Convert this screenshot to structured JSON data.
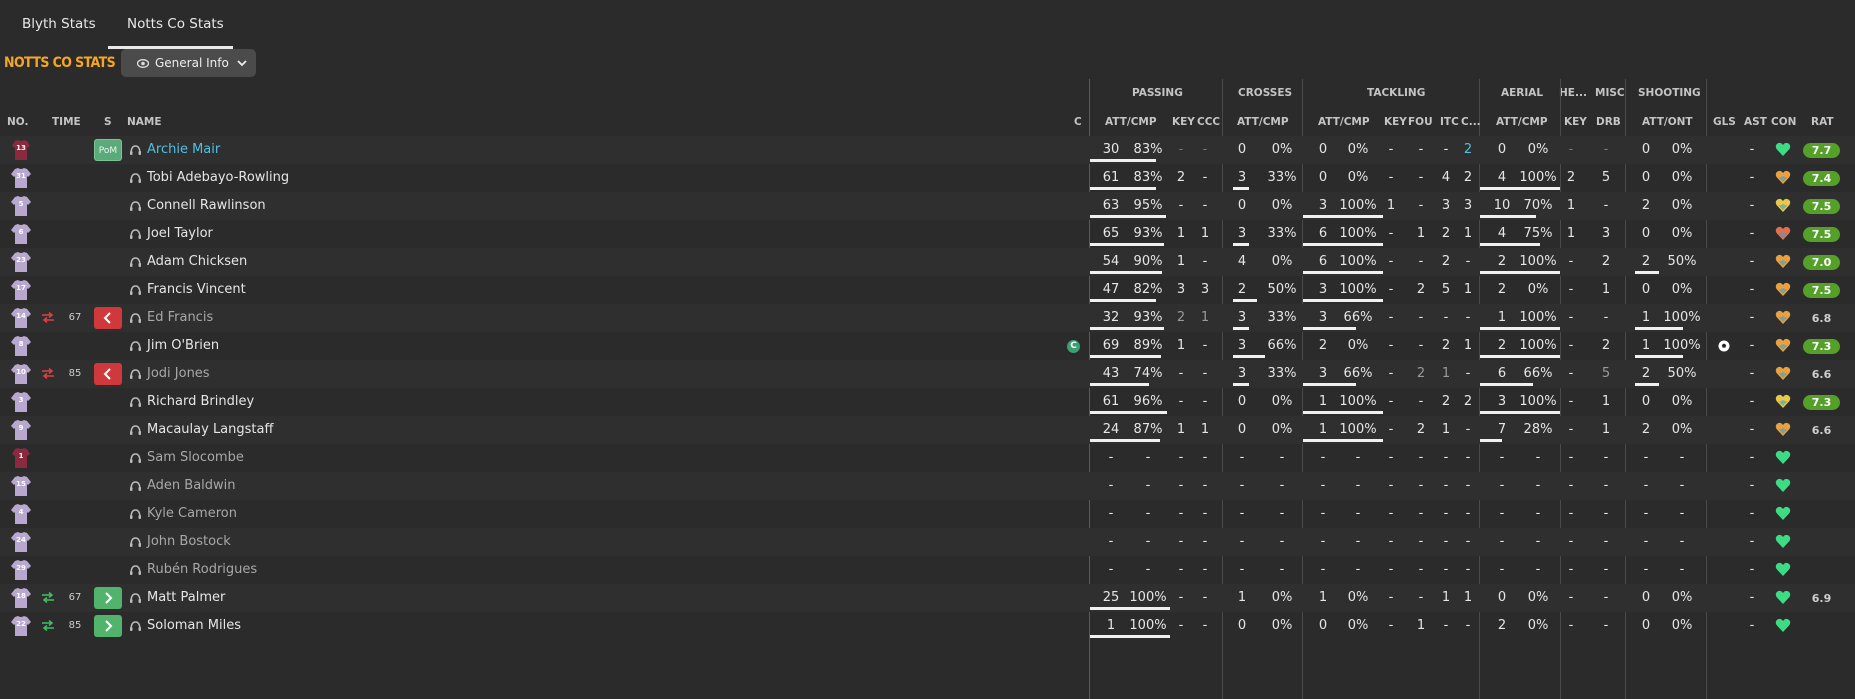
{
  "tabs": [
    {
      "label": "Blyth Stats"
    },
    {
      "label": "Notts Co Stats"
    }
  ],
  "title": "NOTTS CO STATS",
  "view_selector": {
    "label": "General Info"
  },
  "groups": {
    "passing": "PASSING",
    "crosses": "CROSSES",
    "tackling": "TACKLING",
    "aerial": "AERIAL",
    "headers": "HE...",
    "misc": "MISC",
    "shooting": "SHOOTING"
  },
  "columns": {
    "no": "NO.",
    "time": "TIME",
    "s": "S",
    "name": "NAME",
    "c": "C",
    "pass_att_cmp": "ATT/CMP",
    "pass_key": "KEY",
    "pass_ccc": "CCC",
    "cross_att_cmp": "ATT/CMP",
    "tack_att_cmp": "ATT/CMP",
    "tack_key": "KEY",
    "tack_fou": "FOU",
    "tack_itc": "ITC",
    "tack_c": "C...",
    "aer_att_cmp": "ATT/CMP",
    "he_key": "KEY",
    "misc_drb": "DRB",
    "shot_att_ont": "ATT/ONT",
    "gls": "GLS",
    "ast": "AST",
    "con": "CON",
    "rat": "RAT"
  },
  "pom_label": "PoM",
  "captain_label": "C",
  "colors": {
    "accent": "#f5a623",
    "link": "#4fc0e0",
    "rating": "#55a028",
    "sub_off": "#d0393c",
    "sub_on": "#52b36d"
  },
  "players": [
    {
      "no": "13",
      "kit": "gk",
      "name": "Archie Mair",
      "status": "pom",
      "link": true,
      "pa": "30",
      "pp": "83%",
      "pf": 0.83,
      "pkey": "-",
      "pccc": "-",
      "pkeyc": "green",
      "pcccc": "green",
      "ca": "0",
      "cp": "0%",
      "cf": 0,
      "ta": "0",
      "tp": "0%",
      "tf": 0,
      "tkey": "-",
      "tfou": "-",
      "titc": "-",
      "tc": "2",
      "tcc": "blue",
      "aa": "0",
      "ap": "0%",
      "af": 0,
      "hkey": "-",
      "hkeyc": "green",
      "drb": "-",
      "drbc": "green",
      "sa": "0",
      "sp": "0%",
      "sf": 0,
      "gls": "",
      "ast": "-",
      "heart": "green",
      "rating": "7.7",
      "rated": true
    },
    {
      "no": "31",
      "kit": "out",
      "name": "Tobi Adebayo-Rowling",
      "pa": "61",
      "pp": "83%",
      "pf": 0.83,
      "pkey": "2",
      "pccc": "-",
      "ca": "3",
      "cp": "33%",
      "cf": 0.33,
      "ta": "0",
      "tp": "0%",
      "tf": 0,
      "tkey": "-",
      "tfou": "-",
      "titc": "4",
      "tc": "2",
      "aa": "4",
      "ap": "100%",
      "af": 1,
      "hkey": "2",
      "drb": "5",
      "sa": "0",
      "sp": "0%",
      "sf": 0,
      "gls": "",
      "ast": "-",
      "heart": "orange",
      "rating": "7.4",
      "rated": true
    },
    {
      "no": "5",
      "kit": "out",
      "name": "Connell Rawlinson",
      "pa": "63",
      "pp": "95%",
      "pf": 0.95,
      "pkey": "-",
      "pccc": "-",
      "ca": "0",
      "cp": "0%",
      "cf": 0,
      "ta": "3",
      "tp": "100%",
      "tf": 1,
      "tkey": "1",
      "tfou": "-",
      "titc": "3",
      "tc": "3",
      "aa": "10",
      "ap": "70%",
      "af": 0.7,
      "hkey": "1",
      "drb": "-",
      "sa": "2",
      "sp": "0%",
      "sf": 0,
      "gls": "",
      "ast": "-",
      "heart": "yellow",
      "rating": "7.5",
      "rated": true
    },
    {
      "no": "6",
      "kit": "out",
      "name": "Joel Taylor",
      "pa": "65",
      "pp": "93%",
      "pf": 0.93,
      "pkey": "1",
      "pccc": "1",
      "ca": "3",
      "cp": "33%",
      "cf": 0.33,
      "ta": "6",
      "tp": "100%",
      "tf": 1,
      "tkey": "-",
      "tfou": "1",
      "titc": "2",
      "tc": "1",
      "aa": "4",
      "ap": "75%",
      "af": 0.75,
      "hkey": "1",
      "drb": "3",
      "sa": "0",
      "sp": "0%",
      "sf": 0,
      "gls": "",
      "ast": "-",
      "heart": "red",
      "rating": "7.5",
      "rated": true
    },
    {
      "no": "23",
      "kit": "out",
      "name": "Adam Chicksen",
      "pa": "54",
      "pp": "90%",
      "pf": 0.9,
      "pkey": "1",
      "pccc": "-",
      "ca": "4",
      "cp": "0%",
      "cf": 0,
      "ta": "6",
      "tp": "100%",
      "tf": 1,
      "tkey": "-",
      "tfou": "-",
      "titc": "2",
      "tc": "-",
      "aa": "2",
      "ap": "100%",
      "af": 1,
      "hkey": "-",
      "drb": "2",
      "sa": "2",
      "sp": "50%",
      "sf": 0.5,
      "gls": "",
      "ast": "-",
      "heart": "orange",
      "rating": "7.0",
      "rated": true
    },
    {
      "no": "17",
      "kit": "out",
      "name": "Francis Vincent",
      "pa": "47",
      "pp": "82%",
      "pf": 0.82,
      "pkey": "3",
      "pccc": "3",
      "ca": "2",
      "cp": "50%",
      "cf": 0.5,
      "ta": "3",
      "tp": "100%",
      "tf": 1,
      "tkey": "-",
      "tfou": "2",
      "titc": "5",
      "tc": "1",
      "aa": "2",
      "ap": "0%",
      "af": 0,
      "hkey": "-",
      "drb": "1",
      "sa": "0",
      "sp": "0%",
      "sf": 0,
      "gls": "",
      "ast": "-",
      "heart": "orange",
      "rating": "7.5",
      "rated": true
    },
    {
      "no": "14",
      "kit": "out",
      "name": "Ed Francis",
      "status": "off",
      "time": "67",
      "dim": true,
      "pa": "32",
      "pp": "93%",
      "pf": 0.93,
      "pkey": "2",
      "pccc": "1",
      "pkeyc": "dim",
      "pcccc": "dim",
      "ca": "3",
      "cp": "33%",
      "cf": 0.33,
      "ta": "3",
      "tp": "66%",
      "tf": 0.66,
      "tkey": "-",
      "tfou": "-",
      "titc": "-",
      "tc": "-",
      "aa": "1",
      "ap": "100%",
      "af": 1,
      "hkey": "-",
      "drb": "-",
      "sa": "1",
      "sp": "100%",
      "sf": 1,
      "gls": "",
      "ast": "-",
      "heart": "orange",
      "rating": "6.8",
      "rated": false
    },
    {
      "no": "8",
      "kit": "out",
      "name": "Jim O'Brien",
      "captain": true,
      "pa": "69",
      "pp": "89%",
      "pf": 0.89,
      "pkey": "1",
      "pccc": "-",
      "ca": "3",
      "cp": "66%",
      "cf": 0.66,
      "ta": "2",
      "tp": "0%",
      "tf": 0,
      "tkey": "-",
      "tfou": "-",
      "titc": "2",
      "tc": "1",
      "aa": "2",
      "ap": "100%",
      "af": 1,
      "hkey": "-",
      "drb": "2",
      "sa": "1",
      "sp": "100%",
      "sf": 1,
      "gls": "ball",
      "ast": "-",
      "heart": "orange",
      "rating": "7.3",
      "rated": true
    },
    {
      "no": "10",
      "kit": "out",
      "name": "Jodi Jones",
      "status": "off",
      "time": "85",
      "dim": true,
      "pa": "43",
      "pp": "74%",
      "pf": 0.74,
      "pkey": "-",
      "pccc": "-",
      "ca": "3",
      "cp": "33%",
      "cf": 0.33,
      "ta": "3",
      "tp": "66%",
      "tf": 0.66,
      "tkey": "-",
      "tfou": "2",
      "titc": "1",
      "tc": "-",
      "tfouc": "dim",
      "titcc": "dim",
      "aa": "6",
      "ap": "66%",
      "af": 0.66,
      "hkey": "-",
      "drb": "5",
      "drbc": "dim",
      "sa": "2",
      "sp": "50%",
      "sf": 0.5,
      "gls": "",
      "ast": "-",
      "heart": "orange",
      "rating": "6.6",
      "rated": false
    },
    {
      "no": "3",
      "kit": "out",
      "name": "Richard Brindley",
      "pa": "61",
      "pp": "96%",
      "pf": 0.96,
      "pkey": "-",
      "pccc": "-",
      "ca": "0",
      "cp": "0%",
      "cf": 0,
      "ta": "1",
      "tp": "100%",
      "tf": 1,
      "tkey": "-",
      "tfou": "-",
      "titc": "2",
      "tc": "2",
      "aa": "3",
      "ap": "100%",
      "af": 1,
      "hkey": "-",
      "drb": "1",
      "sa": "0",
      "sp": "0%",
      "sf": 0,
      "gls": "",
      "ast": "-",
      "heart": "yellow",
      "rating": "7.3",
      "rated": true
    },
    {
      "no": "9",
      "kit": "out",
      "name": "Macaulay Langstaff",
      "pa": "24",
      "pp": "87%",
      "pf": 0.87,
      "pkey": "1",
      "pccc": "1",
      "ca": "0",
      "cp": "0%",
      "cf": 0,
      "ta": "1",
      "tp": "100%",
      "tf": 1,
      "tkey": "-",
      "tfou": "2",
      "titc": "1",
      "tc": "-",
      "aa": "7",
      "ap": "28%",
      "af": 0.28,
      "hkey": "-",
      "drb": "1",
      "sa": "2",
      "sp": "0%",
      "sf": 0,
      "gls": "",
      "ast": "-",
      "heart": "orange",
      "rating": "6.6",
      "rated": false
    },
    {
      "no": "1",
      "kit": "gk",
      "name": "Sam Slocombe",
      "dim": true,
      "empty": true,
      "heart": "green"
    },
    {
      "no": "15",
      "kit": "out",
      "name": "Aden Baldwin",
      "dim": true,
      "empty": true,
      "heart": "green"
    },
    {
      "no": "4",
      "kit": "out",
      "name": "Kyle Cameron",
      "dim": true,
      "empty": true,
      "heart": "green"
    },
    {
      "no": "24",
      "kit": "out",
      "name": "John Bostock",
      "dim": true,
      "empty": true,
      "heart": "green"
    },
    {
      "no": "29",
      "kit": "out",
      "name": "Rubén Rodrigues",
      "dim": true,
      "empty": true,
      "heart": "green"
    },
    {
      "no": "18",
      "kit": "out",
      "name": "Matt Palmer",
      "status": "on",
      "time": "67",
      "pa": "25",
      "pp": "100%",
      "pf": 1,
      "pkey": "-",
      "pccc": "-",
      "ca": "1",
      "cp": "0%",
      "cf": 0,
      "ta": "1",
      "tp": "0%",
      "tf": 0,
      "tkey": "-",
      "tfou": "-",
      "titc": "1",
      "tc": "1",
      "aa": "0",
      "ap": "0%",
      "af": 0,
      "hkey": "-",
      "drb": "-",
      "sa": "0",
      "sp": "0%",
      "sf": 0,
      "gls": "",
      "ast": "-",
      "heart": "green",
      "rating": "6.9",
      "rated": false
    },
    {
      "no": "22",
      "kit": "out",
      "name": "Soloman Miles",
      "status": "on",
      "time": "85",
      "pa": "1",
      "pp": "100%",
      "pf": 1,
      "pkey": "-",
      "pccc": "-",
      "ca": "0",
      "cp": "0%",
      "cf": 0,
      "ta": "0",
      "tp": "0%",
      "tf": 0,
      "tkey": "-",
      "tfou": "1",
      "titc": "-",
      "tc": "-",
      "aa": "2",
      "ap": "0%",
      "af": 0,
      "hkey": "-",
      "drb": "-",
      "sa": "0",
      "sp": "0%",
      "sf": 0,
      "gls": "",
      "ast": "-",
      "heart": "green",
      "rating": "",
      "rated": false
    }
  ]
}
